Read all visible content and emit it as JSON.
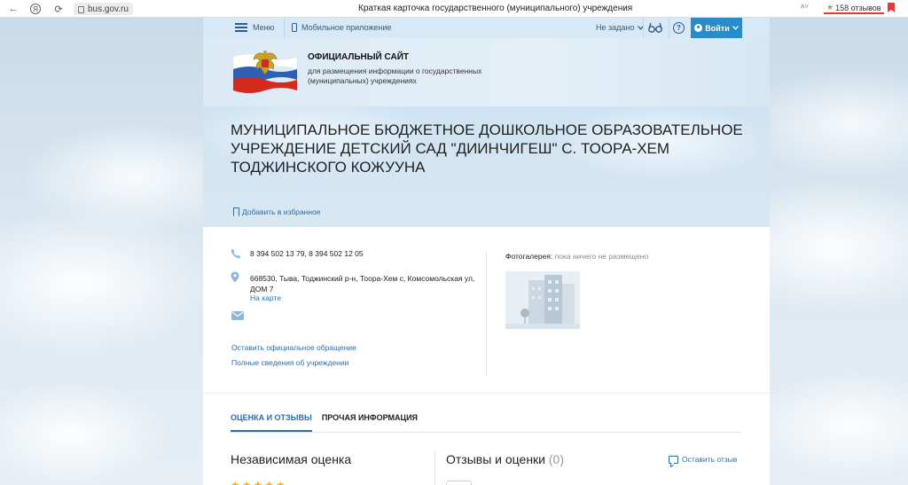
{
  "browser": {
    "url": "bus.gov.ru",
    "page_title": "Краткая карточка государственного (муниципального) учреждения",
    "reviews_badge": "158 отзывов"
  },
  "topnav": {
    "menu_label": "Меню",
    "mobile_label": "Мобильное приложение",
    "region_label": "Не задано",
    "help_label": "?",
    "login_label": "Войти"
  },
  "header": {
    "site_title": "ОФИЦИАЛЬНЫЙ САЙТ",
    "site_subtitle": "для размещения информации о государственных (муниципальных) учреждениях"
  },
  "organization": {
    "name": "МУНИЦИПАЛЬНОЕ БЮДЖЕТНОЕ ДОШКОЛЬНОЕ ОБРАЗОВАТЕЛЬНОЕ УЧРЕЖДЕНИЕ ДЕТСКИЙ САД \"ДИИНЧИГЕШ\" С. ТООРА-ХЕМ ТОДЖИНСКОГО КОЖУУНА",
    "add_favorite": "Добавить в избранное"
  },
  "contacts": {
    "phones": "8 394 502 13 79, 8 394 502 12 05",
    "address": "668530, Тыва, Тоджинский р-н, Тоора-Хем с, Комсомольская ул, ДОМ 7",
    "map_link": "На карте",
    "appeal_link": "Оставить официальное обращение",
    "full_info_link": "Полные сведения об учреждении"
  },
  "gallery": {
    "label": "Фотогалерея:",
    "status": " пока ничего не размещено"
  },
  "tabs": [
    {
      "label": "ОЦЕНКА И ОТЗЫВЫ",
      "active": true
    },
    {
      "label": "ПРОЧАЯ ИНФОРМАЦИЯ",
      "active": false
    }
  ],
  "ratings": {
    "independent_title": "Независимая оценка",
    "stars": "★★★★★",
    "reviews_title": "Отзывы и оценки",
    "reviews_count": "(0)",
    "leave_review": "Оставить отзыв"
  },
  "colors": {
    "accent": "#2a8bc9",
    "link": "#2c6ea8",
    "nav_bg": "#d8e9f5"
  }
}
